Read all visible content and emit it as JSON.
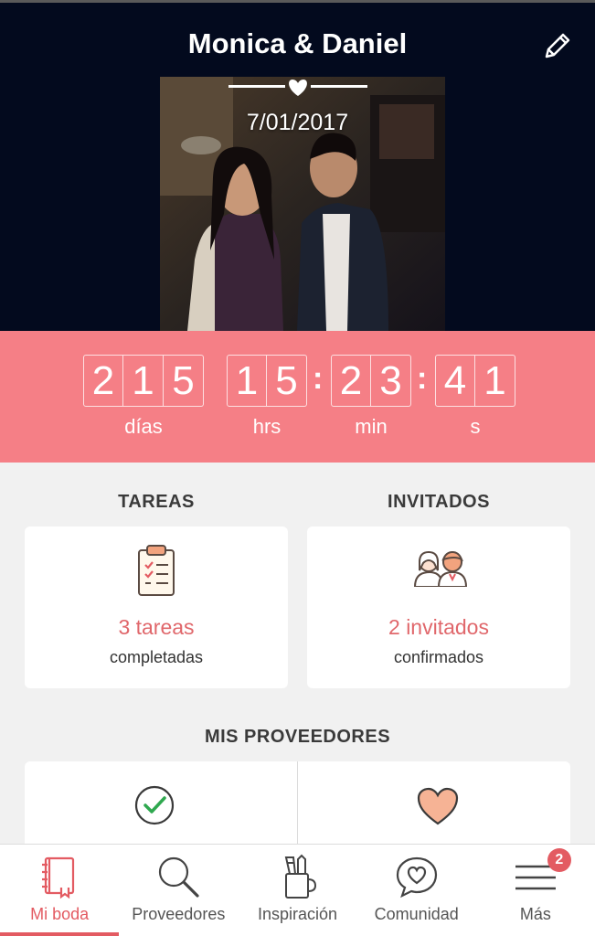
{
  "header": {
    "couple_name": "Monica & Daniel",
    "wedding_date": "7/01/2017"
  },
  "countdown": {
    "days": [
      "2",
      "1",
      "5"
    ],
    "hours": [
      "1",
      "5"
    ],
    "minutes": [
      "2",
      "3"
    ],
    "seconds": [
      "4",
      "1"
    ],
    "separator": ":",
    "labels": {
      "days": "días",
      "hours": "hrs",
      "minutes": "min",
      "seconds": "s"
    }
  },
  "tasks": {
    "title": "TAREAS",
    "value": "3 tareas",
    "sub": "completadas"
  },
  "guests": {
    "title": "INVITADOS",
    "value": "2 invitados",
    "sub": "confirmados"
  },
  "vendors": {
    "title": "MIS PROVEEDORES"
  },
  "nav": {
    "items": [
      {
        "label": "Mi boda",
        "icon": "notebook-icon"
      },
      {
        "label": "Proveedores",
        "icon": "search-icon"
      },
      {
        "label": "Inspiración",
        "icon": "pencil-cup-icon"
      },
      {
        "label": "Comunidad",
        "icon": "chat-heart-icon"
      },
      {
        "label": "Más",
        "icon": "menu-icon"
      }
    ],
    "badge_count": "2"
  },
  "colors": {
    "accent": "#f57f86",
    "accent_text": "#e0676b",
    "hero_bg": "#030a1e"
  }
}
